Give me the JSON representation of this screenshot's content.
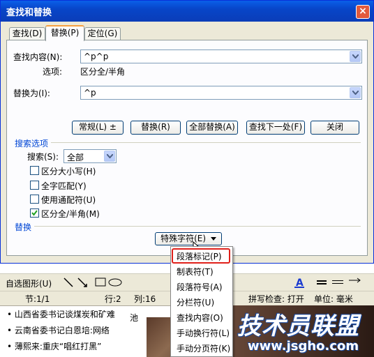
{
  "window": {
    "title": "查找和替换",
    "close": "×"
  },
  "tabs": [
    {
      "label": "查找(D)"
    },
    {
      "label": "替换(P)"
    },
    {
      "label": "定位(G)"
    }
  ],
  "find": {
    "label": "查找内容(N):",
    "value": "^p^p",
    "options_label": "选项:",
    "options_value": "区分全/半角"
  },
  "replace": {
    "label": "替换为(I):",
    "value": "^p"
  },
  "buttons": {
    "normal": "常规(L) ±",
    "replace": "替换(R)",
    "replace_all": "全部替换(A)",
    "find_next": "查找下一处(F)",
    "close": "关闭"
  },
  "search_options": {
    "title": "搜索选项",
    "search_label": "搜索(S):",
    "search_value": "全部",
    "checkboxes": [
      {
        "label": "区分大小写(H)",
        "checked": false
      },
      {
        "label": "全字匹配(Y)",
        "checked": false
      },
      {
        "label": "使用通配符(U)",
        "checked": false
      },
      {
        "label": "区分全/半角(M)",
        "checked": true
      }
    ]
  },
  "replace_section": {
    "title": "替换",
    "special_button": "特殊字符(E)"
  },
  "special_menu": [
    "段落标记(P)",
    "制表符(T)",
    "段落符号(A)",
    "分栏符(U)",
    "查找内容(O)",
    "手动换行符(L)",
    "手动分页符(K)"
  ],
  "toolbar": {
    "autoshape": "自选图形(U)"
  },
  "statusbar": {
    "section": "节:1/1",
    "line": "行:2",
    "column": "列:16",
    "spelling": "拼写检查: 打开",
    "unit": "单位: 毫米"
  },
  "news": [
    "• 山西省委书记谈煤炭和矿难",
    "• 云南省委书记白恩培:网络",
    "• 薄熙来:重庆“唱红打黑”"
  ],
  "doc_text": "池",
  "watermark": {
    "brand": "技术员联盟",
    "url": "www.jsgho.com"
  }
}
